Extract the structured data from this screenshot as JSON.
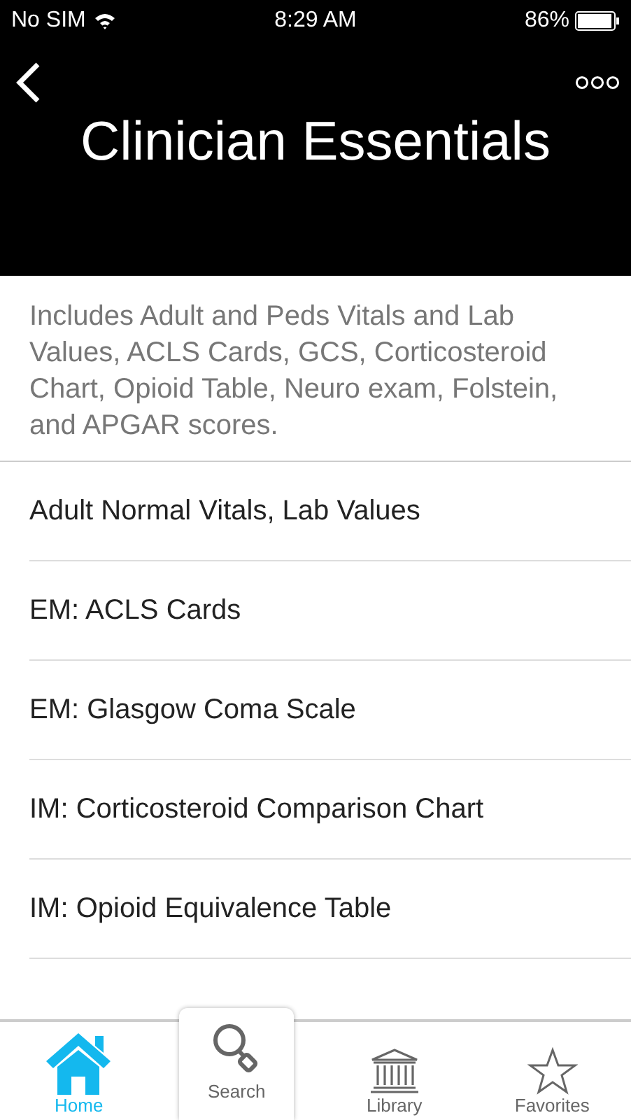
{
  "status_bar": {
    "carrier": "No SIM",
    "time": "8:29 AM",
    "battery": "86%"
  },
  "header": {
    "title": "Clinician Essentials"
  },
  "description": "Includes Adult and Peds Vitals and Lab Values, ACLS Cards, GCS, Corticosteroid Chart, Opioid Table, Neuro exam, Folstein, and APGAR scores.",
  "items": [
    "Adult Normal Vitals, Lab Values",
    "EM: ACLS Cards",
    "EM: Glasgow Coma Scale",
    "IM: Corticosteroid Comparison Chart",
    "IM: Opioid Equivalence Table"
  ],
  "tab_bar": [
    {
      "label": "Home",
      "kind": "home",
      "selected": true,
      "raised": false
    },
    {
      "label": "Search",
      "kind": "search",
      "selected": false,
      "raised": true
    },
    {
      "label": "Library",
      "kind": "library",
      "selected": false,
      "raised": false
    },
    {
      "label": "Favorites",
      "kind": "favorites",
      "selected": false,
      "raised": false
    }
  ]
}
